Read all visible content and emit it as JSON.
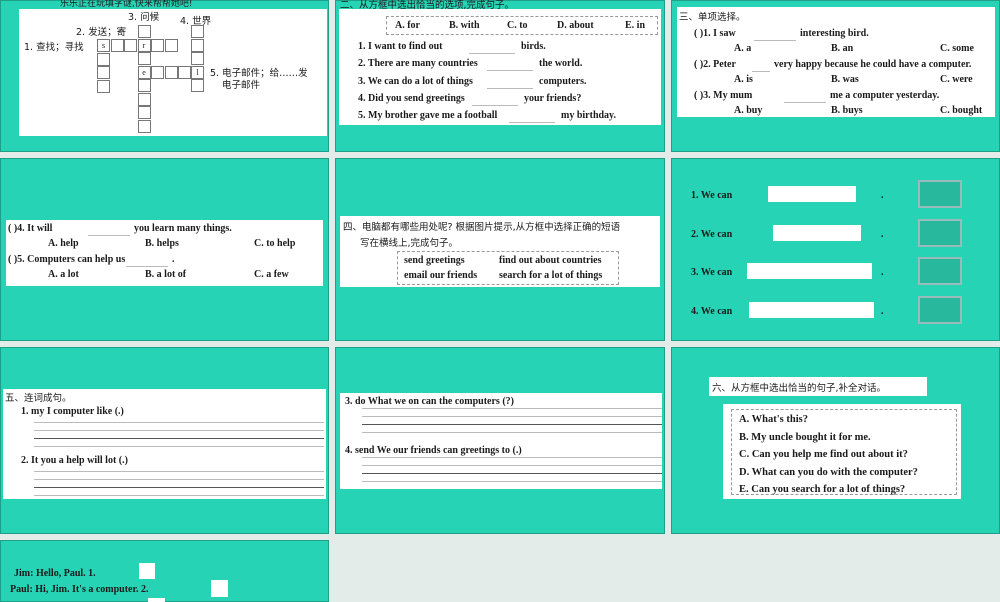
{
  "s1": {
    "header": "乐乐正在玩填字谜,快来帮帮她吧!",
    "clues": [
      "1. 查找；寻找",
      "2. 发送；寄",
      "3. 问候",
      "4. 世界",
      "5. 电子邮件；给……发",
      "电子邮件"
    ],
    "letters": [
      "s",
      "r",
      "e",
      "l"
    ]
  },
  "s2": {
    "header": "二、从方框中选出恰当的选项,完成句子。",
    "options": [
      "A. for",
      "B. with",
      "C. to",
      "D. about",
      "E. in"
    ],
    "items": [
      [
        "1. I want to find out",
        "birds."
      ],
      [
        "2. There are many countries",
        "the world."
      ],
      [
        "3. We can do a lot of things",
        "computers."
      ],
      [
        "4. Did you send greetings",
        "your friends?"
      ],
      [
        "5. My brother gave me a football",
        "my birthday."
      ]
    ]
  },
  "s3": {
    "header": "三、单项选择。",
    "items": [
      {
        "q": "( )1. I saw",
        "q2": "interesting bird.",
        "o": [
          "A. a",
          "B. an",
          "C. some"
        ]
      },
      {
        "q": "( )2. Peter",
        "q2": "very happy because he could have a computer.",
        "o": [
          "A. is",
          "B. was",
          "C. were"
        ]
      },
      {
        "q": "( )3. My mum",
        "q2": "me a computer yesterday.",
        "o": [
          "A. buy",
          "B. buys",
          "C. bought"
        ]
      }
    ]
  },
  "s4": {
    "items": [
      {
        "q": "( )4. It will",
        "q2": "you learn many things.",
        "o": [
          "A. help",
          "B. helps",
          "C. to help"
        ]
      },
      {
        "q": "( )5. Computers can help us",
        "q2": ".",
        "o": [
          "A. a lot",
          "B. a lot of",
          "C. a few"
        ]
      }
    ]
  },
  "s5": {
    "header": "四、电脑都有哪些用处呢? 根据图片提示,从方框中选择正确的短语",
    "header2": "写在横线上,完成句子。",
    "phrases": [
      "send greetings",
      "find out about countries",
      "email our friends",
      "search for a lot of things"
    ]
  },
  "s6": {
    "items": [
      "1. We can",
      "2. We can",
      "3. We can",
      "4. We can"
    ],
    "period": "."
  },
  "s7": {
    "header": "五、连词成句。",
    "items": [
      "1. my   I   computer   like   (.)",
      "2. It   you   a   help   will   lot   (.)"
    ]
  },
  "s8": {
    "items": [
      "3. do   What   we   on   can   the   computers   (?)",
      "4. send   We   our   friends   can   greetings   to   (.)"
    ]
  },
  "s9": {
    "header": "六、从方框中选出恰当的句子,补全对话。",
    "options": [
      "A. What's this?",
      "B. My uncle bought it for me.",
      "C. Can you help me find out about it?",
      "D. What can you do with the computer?",
      "E. Can you search for a lot of things?"
    ]
  },
  "s10": {
    "lines": [
      "Jim: Hello, Paul. 1.",
      "Paul: Hi, Jim. It's a computer. 2."
    ]
  },
  "colors": {
    "slide": "#27d3b5",
    "gap": "#e4ecea"
  }
}
